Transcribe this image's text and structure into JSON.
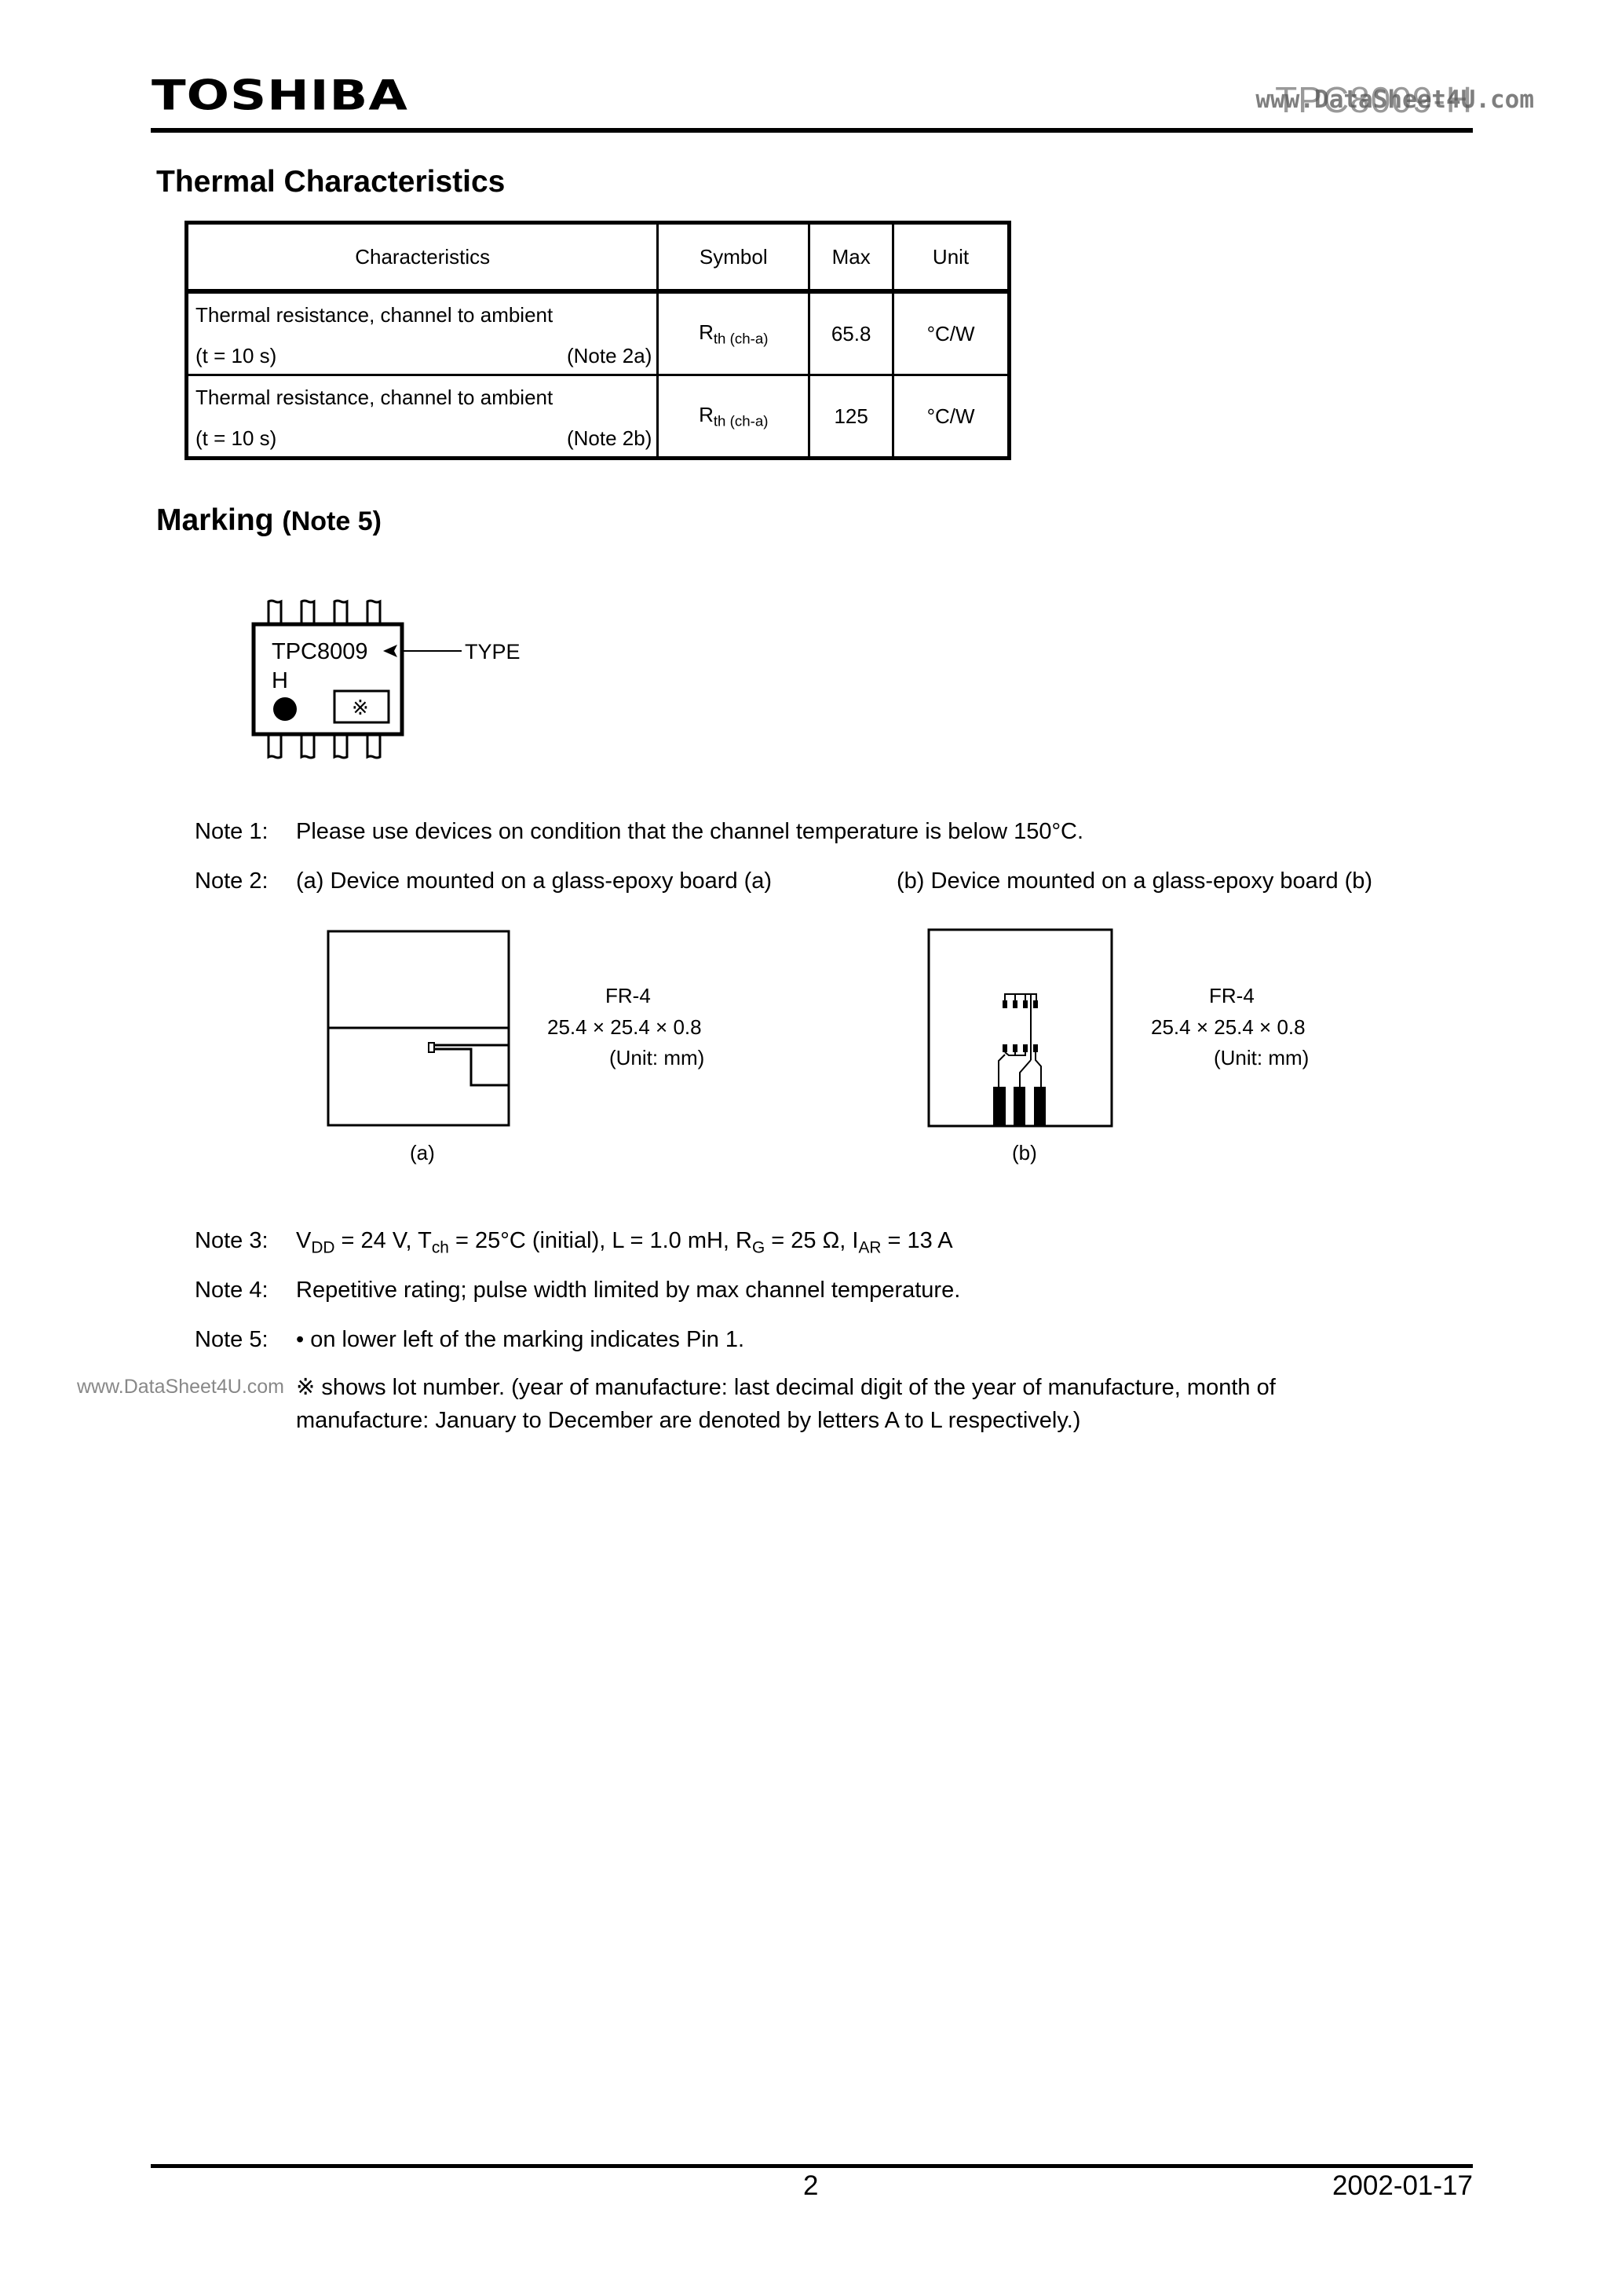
{
  "header": {
    "brand": "TOSHIBA",
    "part_number": "TPC8009-H",
    "watermark": "www.DataSheet4U.com"
  },
  "thermal": {
    "title": "Thermal Characteristics",
    "columns": [
      "Characteristics",
      "Symbol",
      "Max",
      "Unit"
    ],
    "rows": [
      {
        "char_line1": "Thermal resistance, channel to ambient",
        "char_cond": "(t = 10 s)",
        "char_note": "(Note 2a)",
        "symbol_main": "R",
        "symbol_sub": "th (ch-a)",
        "max": "65.8",
        "unit": "°C/W"
      },
      {
        "char_line1": "Thermal resistance, channel to ambient",
        "char_cond": "(t = 10 s)",
        "char_note": "(Note 2b)",
        "symbol_main": "R",
        "symbol_sub": "th (ch-a)",
        "max": "125",
        "unit": "°C/W"
      }
    ]
  },
  "marking": {
    "title": "Marking",
    "title_note": "(Note 5)",
    "type_text": "TPC8009",
    "suffix": "H",
    "lot_symbol": "※",
    "type_label": "TYPE"
  },
  "notes": {
    "note1": {
      "label": "Note 1:",
      "text": "Please use devices on condition that the channel temperature is below 150°C."
    },
    "note2": {
      "label": "Note 2:",
      "text_a": "(a) Device mounted on a glass-epoxy board (a)",
      "text_b": "(b) Device mounted on a glass-epoxy board (b)"
    },
    "boards": [
      {
        "material": "FR-4",
        "size": "25.4 × 25.4 × 0.8",
        "unit": "(Unit: mm)",
        "caption": "(a)"
      },
      {
        "material": "FR-4",
        "size": "25.4 × 25.4 × 0.8",
        "unit": "(Unit: mm)",
        "caption": "(b)"
      }
    ],
    "note3": {
      "label": "Note 3:",
      "vdd": "V",
      "vdd_sub": "DD",
      "vdd_val": " = 24 V, ",
      "tch": "T",
      "tch_sub": "ch",
      "tch_val": " = 25°C (initial), L = 1.0 mH, ",
      "rg": "R",
      "rg_sub": "G",
      "rg_val": " = 25 Ω, ",
      "iar": "I",
      "iar_sub": "AR",
      "iar_val": " = 13 A"
    },
    "note4": {
      "label": "Note 4:",
      "text": "Repetitive rating; pulse width limited by max channel temperature."
    },
    "note5": {
      "label": "Note 5:",
      "text": "• on lower left of the marking indicates Pin 1."
    },
    "lot": {
      "symbol": "※",
      "line1": " shows lot number. (year of manufacture: last decimal digit of the year of manufacture, month of",
      "line2": "manufacture: January to December are denoted by letters A to L respectively.)"
    },
    "side_watermark": "www.DataSheet4U.com"
  },
  "footer": {
    "page": "2",
    "date": "2002-01-17"
  }
}
